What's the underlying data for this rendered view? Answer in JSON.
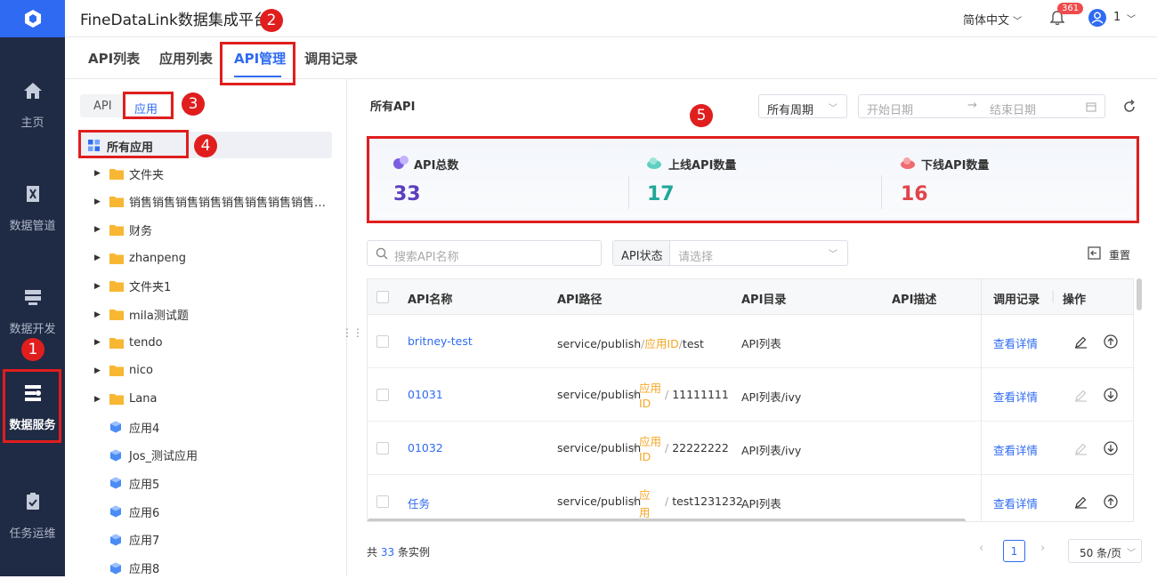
{
  "nav": {
    "items": [
      {
        "label": "主页",
        "icon": "home-icon"
      },
      {
        "label": "数据管道",
        "icon": "pipeline-icon"
      },
      {
        "label": "数据开发",
        "icon": "dev-icon"
      },
      {
        "label": "数据服务",
        "icon": "service-icon"
      },
      {
        "label": "任务运维",
        "icon": "ops-icon"
      }
    ]
  },
  "header": {
    "title": "FineDataLink数据集成平台",
    "language": "简体中文",
    "notification_count": "361",
    "user": "1"
  },
  "tabs": [
    "API列表",
    "应用列表",
    "API管理",
    "调用记录"
  ],
  "subtabs": [
    "API",
    "应用"
  ],
  "tree": {
    "root": "所有应用",
    "folders": [
      "文件夹",
      "销售销售销售销售销售销售销售销售…",
      "财务",
      "zhanpeng",
      "文件夹1",
      "mila测试题",
      "tendo",
      "nico",
      "Lana"
    ],
    "apps": [
      "应用4",
      "Jos_测试应用",
      "应用5",
      "应用6",
      "应用7",
      "应用8"
    ]
  },
  "annotations": [
    "1",
    "2",
    "3",
    "4",
    "5"
  ],
  "main": {
    "section_title": "所有API",
    "period_select": "所有周期",
    "start_date_placeholder": "开始日期",
    "end_date_placeholder": "结束日期",
    "stats": [
      {
        "label": "API总数",
        "value": "33",
        "color": "#5b3fbf"
      },
      {
        "label": "上线API数量",
        "value": "17",
        "color": "#1fa89a"
      },
      {
        "label": "下线API数量",
        "value": "16",
        "color": "#e0454b"
      }
    ],
    "search_placeholder": "搜索API名称",
    "status_label": "API状态",
    "status_placeholder": "请选择",
    "reset_label": "重置",
    "columns": [
      "API名称",
      "API路径",
      "API目录",
      "API描述",
      "调用记录",
      "操作"
    ],
    "rows": [
      {
        "name": "britney-test",
        "path_prefix": "service/publish",
        "path_id": "应用ID",
        "path_suffix": "test",
        "dir": "API列表",
        "record": "查看详情"
      },
      {
        "name": "01031",
        "path_prefix": "service/publish",
        "path_id_1": "应用",
        "path_id_2": "ID",
        "path_suffix": "11111111",
        "dir": "API列表/ivy",
        "record": "查看详情"
      },
      {
        "name": "01032",
        "path_prefix": "service/publish",
        "path_id_1": "应用",
        "path_id_2": "ID",
        "path_suffix": "22222222",
        "dir": "API列表/ivy",
        "record": "查看详情"
      },
      {
        "name": "任务",
        "path_prefix": "service/publish",
        "path_id_1": "应",
        "path_id_2": "用",
        "path_suffix": "test1231232",
        "dir": "API列表",
        "record": "查看详情"
      }
    ],
    "total_prefix": "共",
    "total_count": "33",
    "total_suffix": "条实例",
    "page": "1",
    "page_size": "50 条/页"
  }
}
